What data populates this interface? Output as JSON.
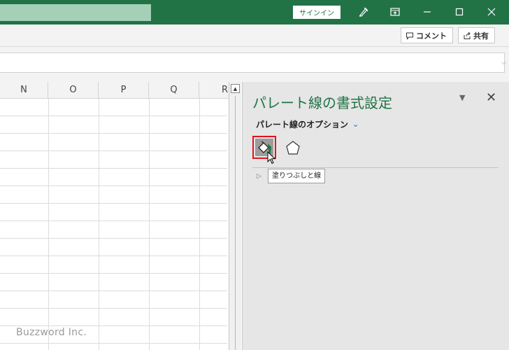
{
  "titlebar": {
    "signin_label": "サインイン",
    "icons": [
      "pen-icon",
      "ribbon-display-icon",
      "minimize-icon",
      "maximize-icon",
      "close-icon"
    ]
  },
  "ribbon": {
    "comment_label": "コメント",
    "share_label": "共有"
  },
  "grid": {
    "columns": [
      "N",
      "O",
      "P",
      "Q",
      "R"
    ]
  },
  "pane": {
    "title": "パレート線の書式設定",
    "subtitle": "パレート線のオプション",
    "tabs": [
      "fill-and-line-icon",
      "effects-icon"
    ],
    "tooltip": "塗りつぶしと線"
  },
  "watermark": "Buzzword Inc.",
  "colors": {
    "accent": "#217346",
    "selection_border": "#e0141c",
    "pane_bg": "#e6e6e6"
  }
}
